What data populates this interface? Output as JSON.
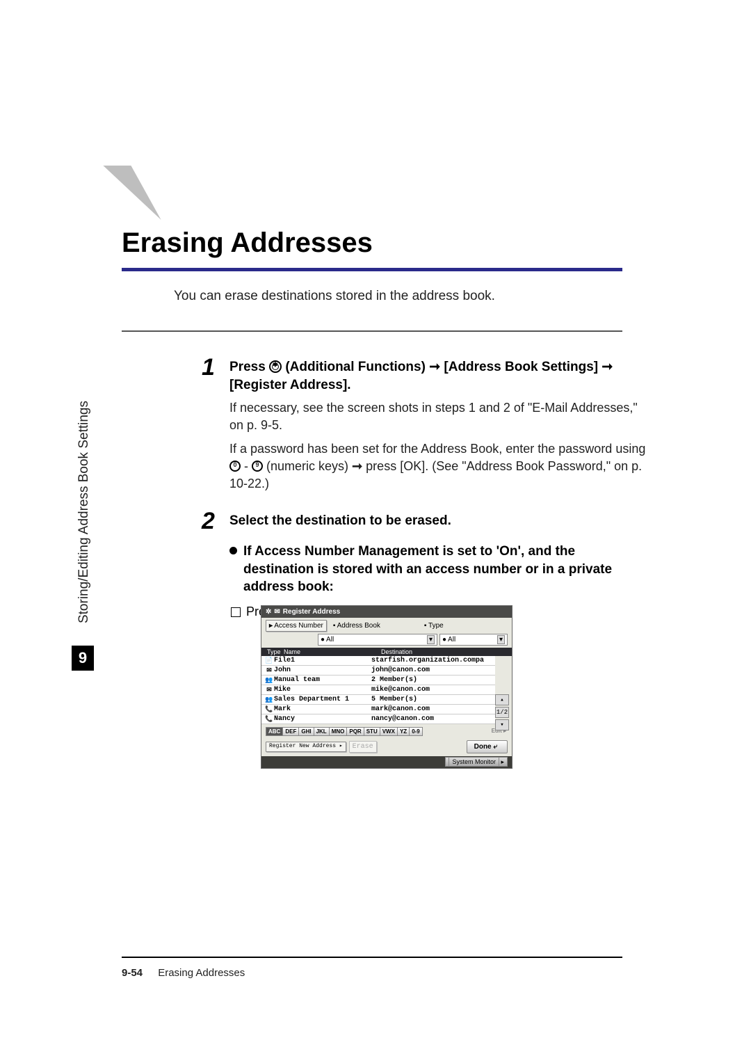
{
  "heading": "Erasing Addresses",
  "intro": "You can erase destinations stored in the address book.",
  "sidebar": "Storing/Editing Address Book Settings",
  "chapter_badge": "9",
  "step1": {
    "num": "1",
    "head_prefix": "Press ",
    "head_mid": " (Additional Functions) ",
    "head_arrow": "➞",
    "head_seg2": " [Address Book Settings] ",
    "head_seg3": " [Register Address].",
    "p1": "If necessary, see the screen shots in steps 1 and 2 of \"E-Mail Addresses,\" on p. 9-5.",
    "p2a": "If a password has been set for the Address Book, enter the password using ",
    "p2_dash": " - ",
    "p2b": " (numeric keys) ",
    "p2c": " press [OK]. (See \"Address Book Password,\" on p. 10-22.)"
  },
  "step2": {
    "num": "2",
    "head": "Select the destination to be erased.",
    "bullet": "If Access Number Management is set to 'On', and the destination is stored with an access number or in a private address book:",
    "check": "Press [Access Number]."
  },
  "mock": {
    "title": "Register Address",
    "access_btn": "Access Number",
    "abook_label": "Address Book",
    "type_label": "Type",
    "abook_val": "All",
    "type_val": "All",
    "hdr_name": "Name",
    "hdr_dest": "Destination",
    "rows": [
      {
        "icon": "📄",
        "name": "File1",
        "dest": "starfish.organization.compa"
      },
      {
        "icon": "✉",
        "name": "John",
        "dest": "john@canon.com"
      },
      {
        "icon": "👥",
        "name": "Manual team",
        "dest": "2 Member(s)"
      },
      {
        "icon": "✉",
        "name": "Mike",
        "dest": "mike@canon.com"
      },
      {
        "icon": "👥",
        "name": "Sales Department 1",
        "dest": "5 Member(s)"
      },
      {
        "icon": "📞",
        "name": "Mark",
        "dest": "mark@canon.com"
      },
      {
        "icon": "📞",
        "name": "Nancy",
        "dest": "nancy@canon.com"
      }
    ],
    "page_indicator": "1/2",
    "alpha": [
      "ABC",
      "DEF",
      "GHI",
      "JKL",
      "MNO",
      "PQR",
      "STU",
      "VWX",
      "YZ",
      "0-9"
    ],
    "edit": "Edit",
    "reg_new": "Register New Address",
    "erase": "Erase",
    "done": "Done",
    "sysmon": "System Monitor"
  },
  "footer": {
    "page": "9-54",
    "title": "Erasing Addresses"
  }
}
